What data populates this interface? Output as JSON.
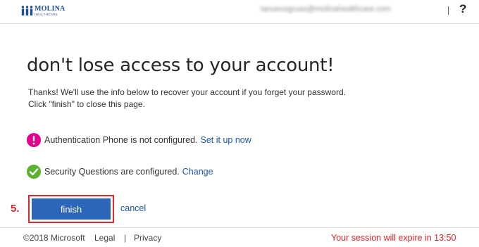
{
  "header": {
    "logo": {
      "name": "MOLINA",
      "sub": "HEALTHCARE",
      "icon": "molina-people-icon"
    },
    "account_email": "lanuevogruas@molinahealthcare.com",
    "help_icon": "?"
  },
  "main": {
    "title": "don't lose access to your account!",
    "description_line1": "Thanks! We'll use the info below to recover your account if you forget your password.",
    "description_line2": "Click \"finish\" to close this page.",
    "phone": {
      "icon": "warning-icon",
      "text": "Authentication Phone is not configured.",
      "link": "Set it up now"
    },
    "questions": {
      "icon": "checkmark-icon",
      "text": "Security Questions are configured.",
      "link": "Change"
    },
    "step_label": "5.",
    "finish_label": "finish",
    "cancel_label": "cancel"
  },
  "footer": {
    "copyright": "©2018 Microsoft",
    "legal": "Legal",
    "separator": "|",
    "privacy": "Privacy",
    "session": "Your session will expire in 13:50"
  },
  "colors": {
    "brand": "#1d4f91",
    "button": "#2c66b8",
    "link": "#1a57a7",
    "warning": "#e3008c",
    "success": "#5cb230",
    "alert_text": "#d9262a"
  }
}
